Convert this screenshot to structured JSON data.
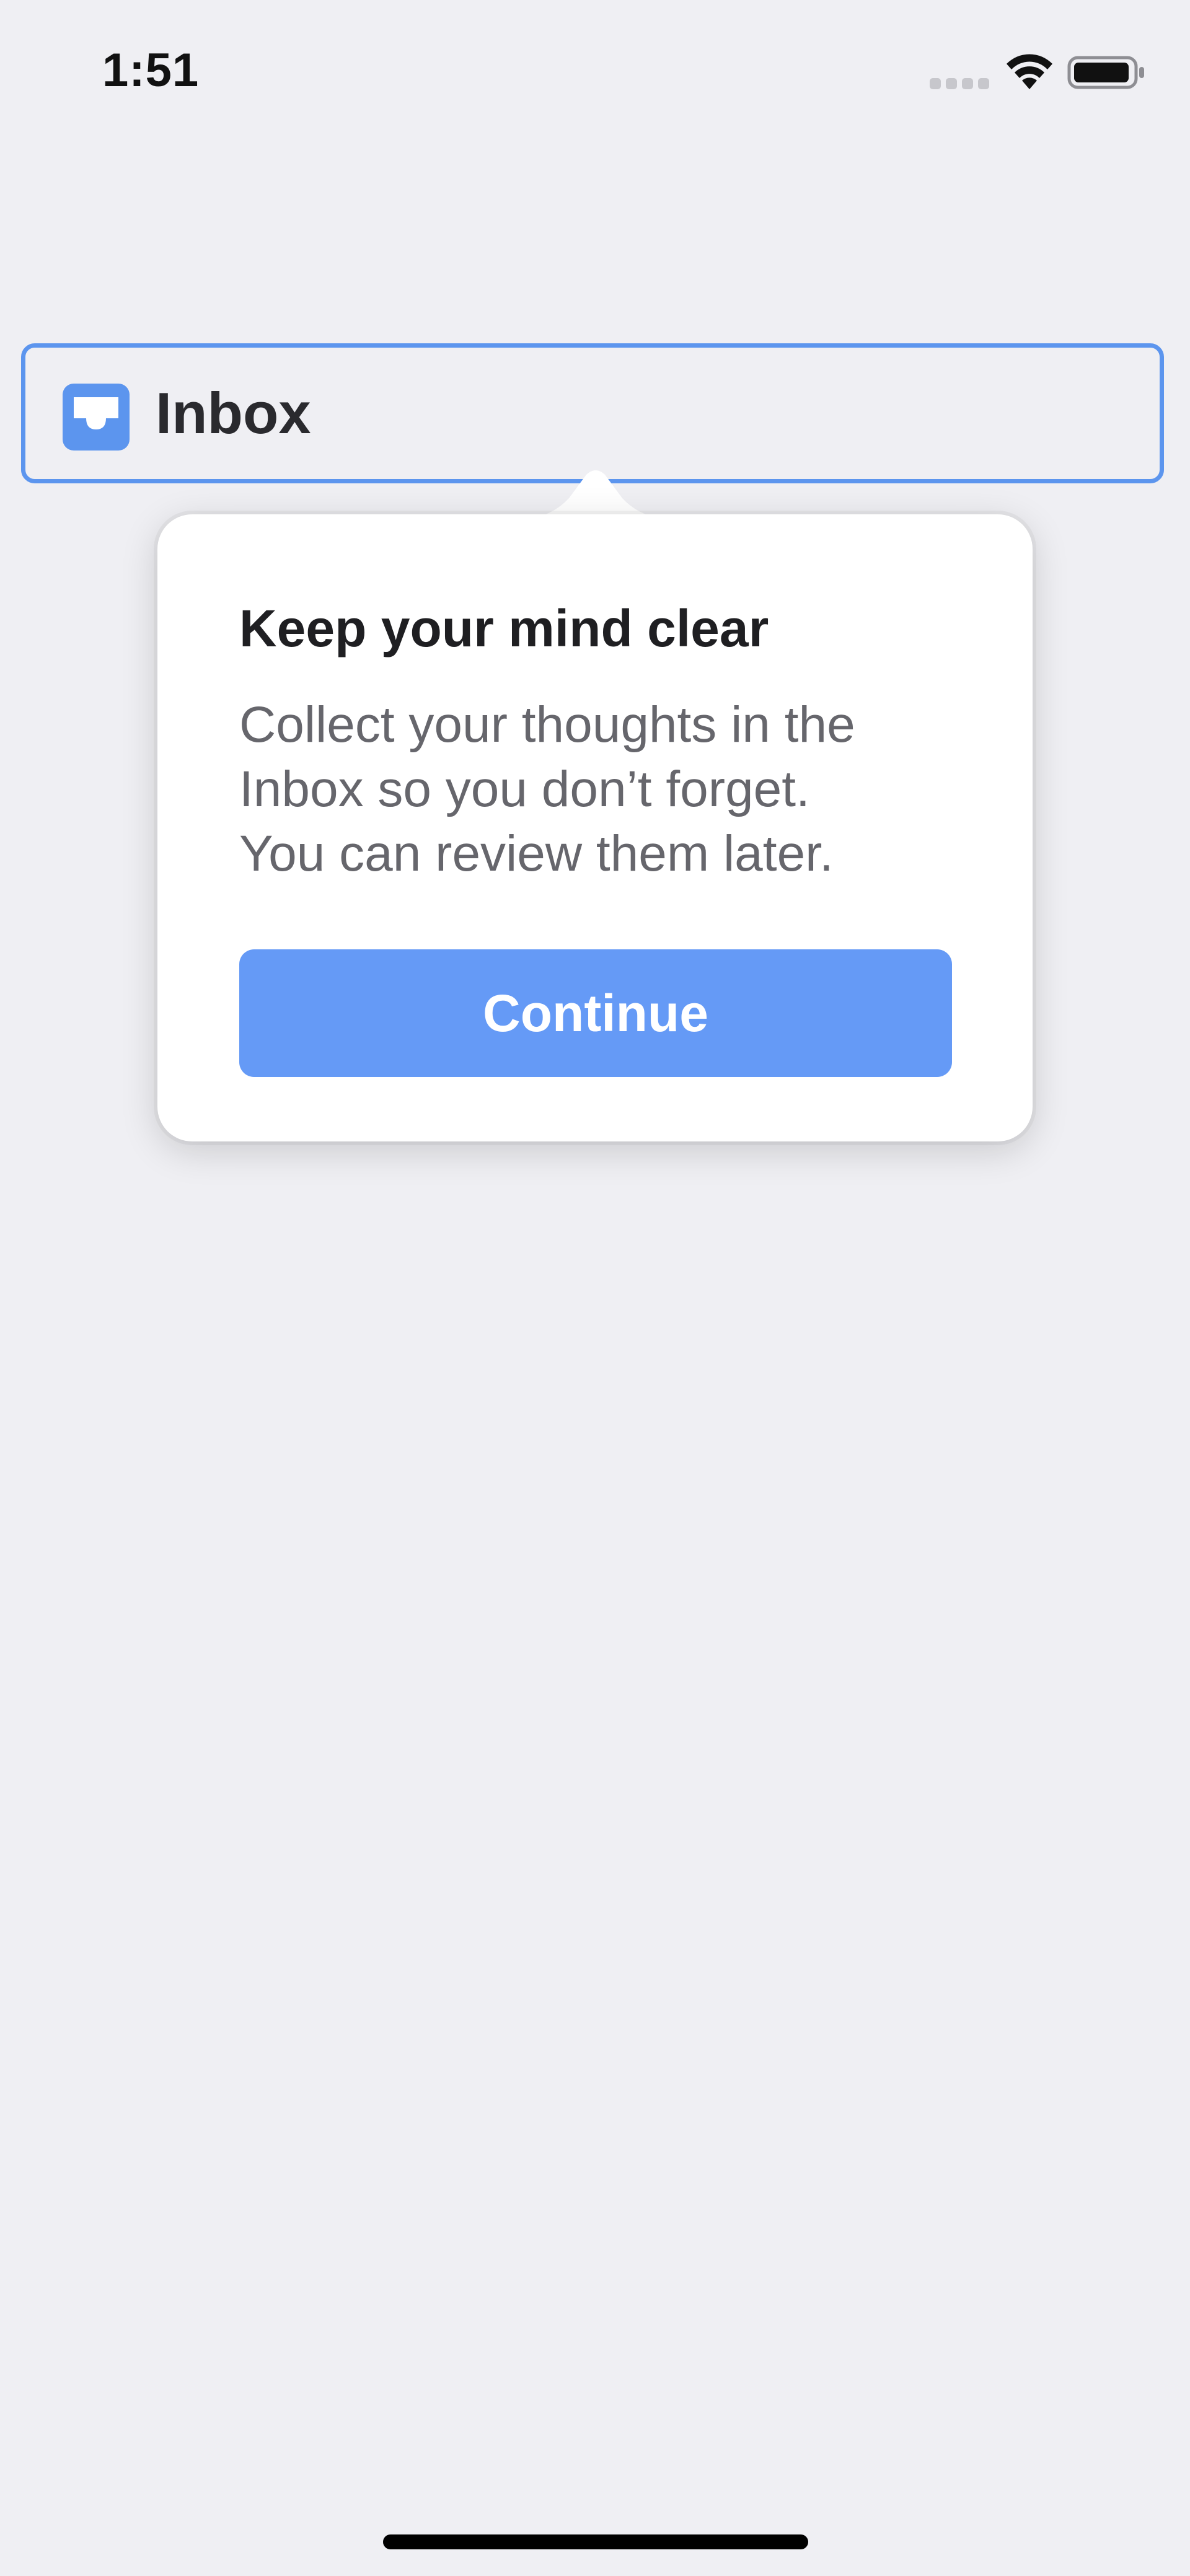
{
  "status_bar": {
    "time": "1:51",
    "icons": [
      "signal-icon",
      "wifi-icon",
      "battery-icon"
    ]
  },
  "inbox": {
    "label": "Inbox",
    "icon": "inbox-tray-icon"
  },
  "popover": {
    "title": "Keep your mind clear",
    "body_lines": [
      "Collect your thoughts in the",
      "Inbox so you don’t forget.",
      "You can review them later."
    ],
    "button_label": "Continue"
  },
  "colors": {
    "accent": "#5c95ee",
    "button": "#659af6",
    "background": "#efeff3",
    "title_text": "#1f1f22",
    "body_text": "#66666c"
  }
}
